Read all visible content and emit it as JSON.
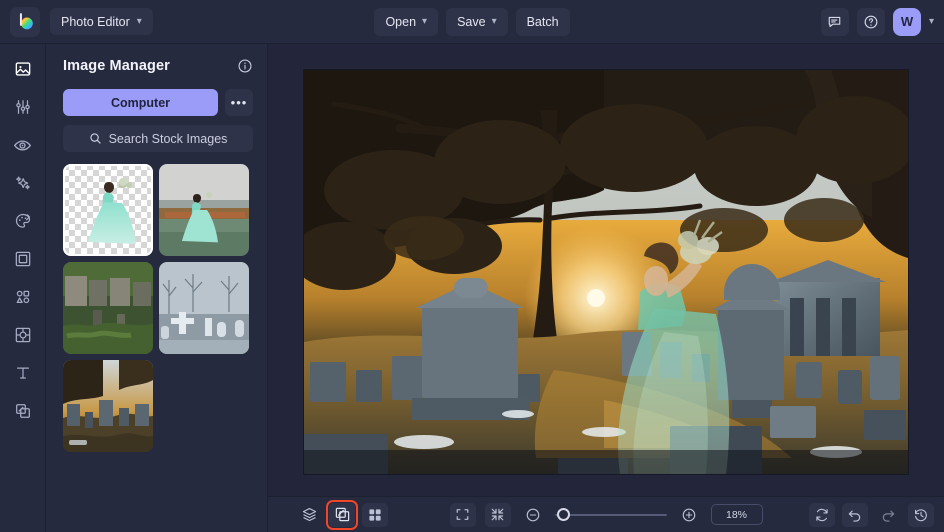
{
  "app": {
    "logo_icon": "colorwheel-b-logo",
    "menu_label": "Photo Editor",
    "menu_caret_icon": "chevron-down-icon"
  },
  "header": {
    "buttons": [
      {
        "label": "Open",
        "icon": "chevron-down-icon",
        "has_caret": true
      },
      {
        "label": "Save",
        "icon": "chevron-down-icon",
        "has_caret": true
      },
      {
        "label": "Batch",
        "icon": "",
        "has_caret": false
      }
    ],
    "right": {
      "feedback_icon": "comment-icon",
      "help_icon": "question-circle-icon",
      "avatar_initial": "W",
      "account_caret_icon": "chevron-down-icon"
    }
  },
  "rail": {
    "items": [
      {
        "name": "image",
        "icon": "image-icon",
        "active": true
      },
      {
        "name": "adjust",
        "icon": "sliders-icon",
        "active": false
      },
      {
        "name": "retouch",
        "icon": "eye-icon",
        "active": false
      },
      {
        "name": "effects",
        "icon": "sparkles-icon",
        "active": false
      },
      {
        "name": "color",
        "icon": "palette-icon",
        "active": false
      },
      {
        "name": "frames",
        "icon": "frame-icon",
        "active": false
      },
      {
        "name": "shapes",
        "icon": "shapes-icon",
        "active": false
      },
      {
        "name": "cutout",
        "icon": "cutout-icon",
        "active": false
      },
      {
        "name": "text",
        "icon": "text-t-icon",
        "active": false
      },
      {
        "name": "layers",
        "icon": "layers-copy-icon",
        "active": false
      }
    ]
  },
  "panel": {
    "title": "Image Manager",
    "info_icon": "info-circle-icon",
    "source_button": "Computer",
    "more_button": "•••",
    "more_icon": "ellipsis-icon",
    "search": {
      "icon": "search-icon",
      "label": "Search Stock Images"
    },
    "thumbnails": [
      {
        "name": "bride-cutout-transparent",
        "selected": true
      },
      {
        "name": "bride-on-shore",
        "selected": false
      },
      {
        "name": "green-cemetery",
        "selected": false
      },
      {
        "name": "snowy-cemetery-bw",
        "selected": false
      },
      {
        "name": "sunset-cemetery",
        "selected": false
      }
    ]
  },
  "canvas": {
    "name": "composited-bride-in-cemetery",
    "alt": "Semi-transparent woman in teal gown composited into a sunset cemetery scene"
  },
  "bottombar": {
    "left_tools": [
      {
        "name": "layers",
        "icon": "layers-icon",
        "boxed": false,
        "highlighted": false
      },
      {
        "name": "transform",
        "icon": "transform-copy-icon",
        "boxed": true,
        "highlighted": true
      },
      {
        "name": "grid-view",
        "icon": "grid-four-icon",
        "boxed": true,
        "highlighted": false
      }
    ],
    "view_tools": [
      {
        "name": "fit-to-screen",
        "icon": "expand-brackets-icon"
      },
      {
        "name": "actual-size",
        "icon": "collapse-arrows-icon"
      }
    ],
    "zoom": {
      "out_icon": "minus-circle-icon",
      "in_icon": "plus-circle-icon",
      "value": "18%",
      "slider_percent": 8
    },
    "right_tools": [
      {
        "name": "reset",
        "icon": "refresh-icon"
      },
      {
        "name": "undo",
        "icon": "undo-arrow-icon"
      },
      {
        "name": "redo",
        "icon": "redo-arrow-icon"
      },
      {
        "name": "history",
        "icon": "history-clock-icon"
      }
    ]
  },
  "colors": {
    "accent": "#9a9cf7",
    "highlight": "#f2462a",
    "chrome": "#262a3e",
    "stage": "#23263a"
  }
}
